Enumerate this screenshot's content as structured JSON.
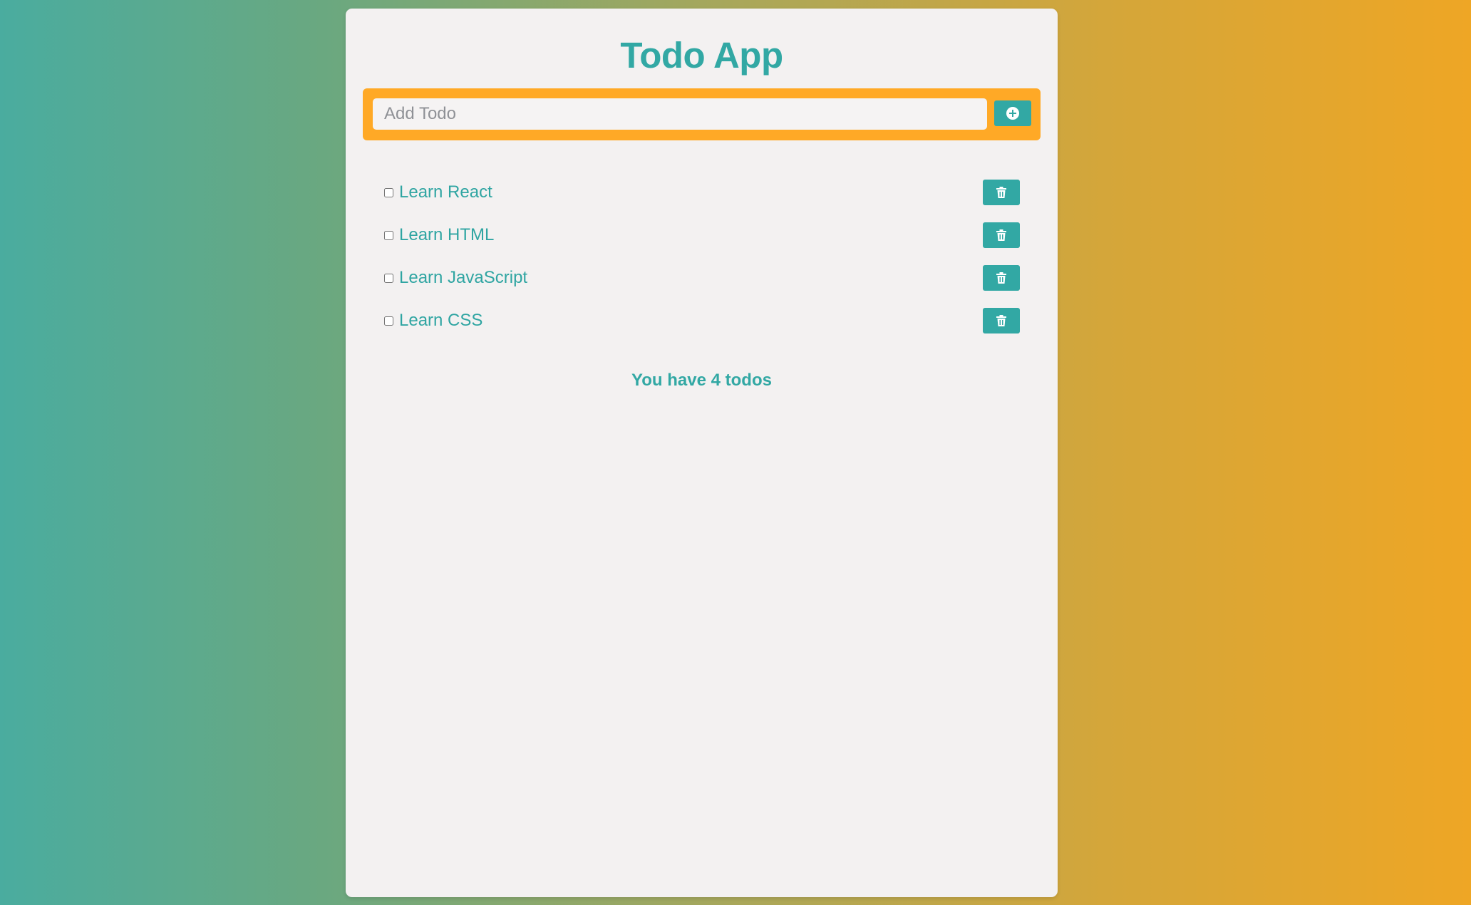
{
  "app": {
    "title": "Todo App"
  },
  "add_form": {
    "input_value": "",
    "input_placeholder": "Add Todo",
    "add_button_icon": "plus-circle-icon"
  },
  "todos": [
    {
      "text": "Learn React",
      "completed": false,
      "delete_icon": "trash-icon"
    },
    {
      "text": "Learn HTML",
      "completed": false,
      "delete_icon": "trash-icon"
    },
    {
      "text": "Learn JavaScript",
      "completed": false,
      "delete_icon": "trash-icon"
    },
    {
      "text": "Learn CSS",
      "completed": false,
      "delete_icon": "trash-icon"
    }
  ],
  "footer": {
    "count_text": "You have 4 todos"
  },
  "colors": {
    "accent": "#32a8a4",
    "add_bar": "#ffa926",
    "card": "#f3f1f1",
    "gradient_left": "#4aac9f",
    "gradient_right": "#eea625"
  }
}
